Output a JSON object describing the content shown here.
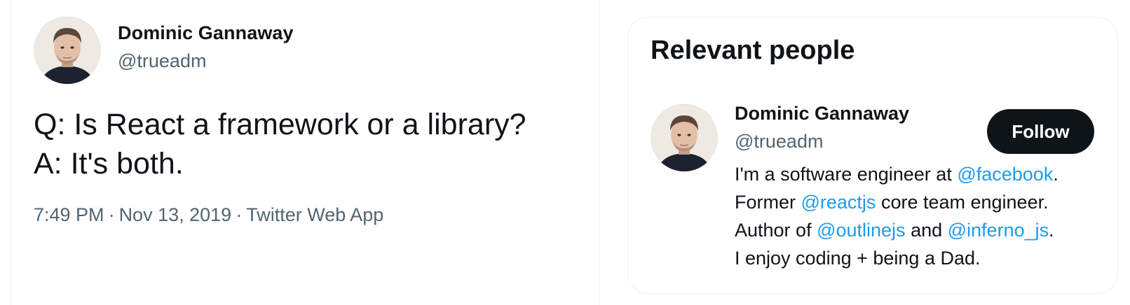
{
  "tweet": {
    "author": {
      "name": "Dominic Gannaway",
      "handle": "@trueadm"
    },
    "text_lines": [
      "Q: Is React a framework or a library?",
      "A: It's both."
    ],
    "time": "7:49 PM",
    "date": "Nov 13, 2019",
    "source": "Twitter Web App",
    "separator": "·"
  },
  "relevant_people": {
    "title": "Relevant people",
    "person": {
      "name": "Dominic Gannaway",
      "handle": "@trueadm",
      "follow_label": "Follow",
      "bio": {
        "l1_a": "I'm a software engineer at ",
        "l1_mention": "@facebook",
        "l1_b": ".",
        "l2_a": "Former ",
        "l2_mention": "@reactjs",
        "l2_b": " core team engineer.",
        "l3_a": "Author of ",
        "l3_mention1": "@outlinejs",
        "l3_b": " and ",
        "l3_mention2": "@inferno_js",
        "l3_c": ".",
        "l4": "I enjoy coding + being a Dad."
      }
    }
  },
  "colors": {
    "text": "#0f1419",
    "secondary": "#536471",
    "link": "#1d9bf0",
    "border": "#eff3f4",
    "button_bg": "#0f1419"
  }
}
